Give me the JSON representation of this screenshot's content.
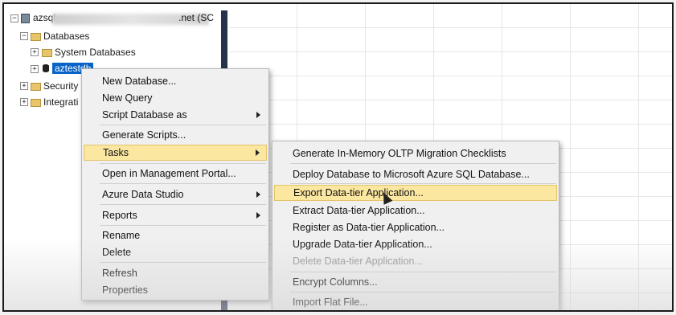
{
  "tree": {
    "server_label_prefix": "azsql",
    "server_label_suffix": ".net (SC",
    "nodes": [
      {
        "label": "Databases"
      },
      {
        "label": "System Databases"
      },
      {
        "label": "aztestdb"
      },
      {
        "label": "Security"
      },
      {
        "label": "Integrati"
      }
    ]
  },
  "context_menu": {
    "items": [
      {
        "label": "New Database..."
      },
      {
        "label": "New Query"
      },
      {
        "label": "Script Database as"
      },
      {
        "label": "Generate Scripts..."
      },
      {
        "label": "Tasks"
      },
      {
        "label": "Open in Management Portal..."
      },
      {
        "label": "Azure Data Studio"
      },
      {
        "label": "Reports"
      },
      {
        "label": "Rename"
      },
      {
        "label": "Delete"
      },
      {
        "label": "Refresh"
      },
      {
        "label": "Properties"
      }
    ]
  },
  "tasks_menu": {
    "items": [
      {
        "label": "Generate In-Memory OLTP Migration Checklists"
      },
      {
        "label": "Deploy Database to Microsoft Azure SQL Database..."
      },
      {
        "label": "Export Data-tier Application..."
      },
      {
        "label": "Extract Data-tier Application..."
      },
      {
        "label": "Register as Data-tier Application..."
      },
      {
        "label": "Upgrade Data-tier Application..."
      },
      {
        "label": "Delete Data-tier Application..."
      },
      {
        "label": "Encrypt Columns..."
      },
      {
        "label": "Import Flat File..."
      }
    ]
  },
  "colors": {
    "highlight": "#fbe7a0",
    "selection": "#0a64c8",
    "splitter": "#24324a"
  }
}
